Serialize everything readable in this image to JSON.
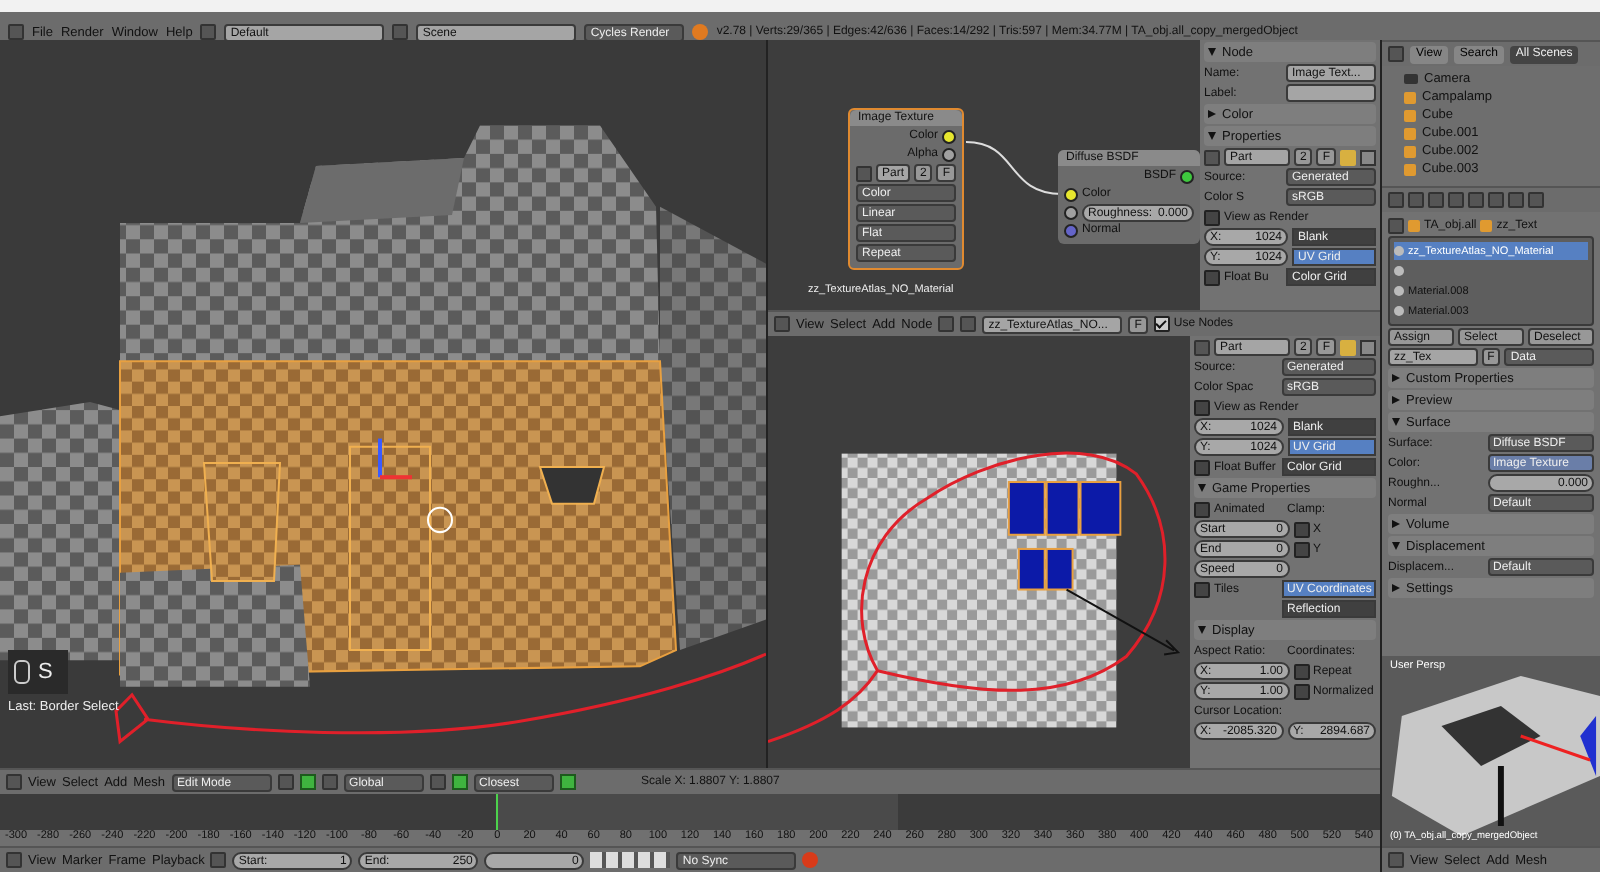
{
  "top_bar": {
    "menus": [
      "File",
      "Render",
      "Window",
      "Help"
    ],
    "screen_layout": "Default",
    "scene": "Scene",
    "render_engine": "Cycles Render",
    "stats": "v2.78 | Verts:29/365 | Edges:42/636 | Faces:14/292 | Tris:597 | Mem:34.77M | TA_obj.all_copy_mergedObject"
  },
  "viewport_3d": {
    "key_hint": "S",
    "last_operator": "Last: Border Select",
    "header": {
      "menus": [
        "View",
        "Select",
        "Add",
        "Mesh"
      ],
      "mode": "Edit Mode",
      "orientation": "Global",
      "snap_target": "Closest",
      "status": "Scale X: 1.8807  Y: 1.8807"
    }
  },
  "node_editor": {
    "image_node": {
      "title": "Image Texture",
      "outputs": [
        "Color",
        "Alpha"
      ],
      "image": "Part",
      "users": "2",
      "fake": "F",
      "options": [
        "Color",
        "Linear",
        "Flat",
        "Repeat"
      ],
      "image_label": "zz_TextureAtlas_NO_Material"
    },
    "diffuse_node": {
      "title": "Diffuse BSDF",
      "output": "BSDF",
      "color_input": "Color",
      "roughness_label": "Roughness:",
      "roughness_value": "0.000",
      "normal_input": "Normal"
    },
    "header": {
      "menus": [
        "View",
        "Select",
        "Add",
        "Node"
      ],
      "material": "zz_TextureAtlas_NO...",
      "fake": "F",
      "use_nodes_label": "Use Nodes",
      "use_nodes": true
    },
    "sidebar": {
      "rows": [
        {
          "kind": "panel",
          "title": "Node",
          "expanded": true
        },
        {
          "kind": "line",
          "cells": [
            {
              "kind": "label",
              "label": "Name:"
            },
            {
              "kind": "field",
              "value": "Image Text..."
            }
          ]
        },
        {
          "kind": "line",
          "cells": [
            {
              "kind": "label",
              "label": "Label:"
            },
            {
              "kind": "field"
            }
          ]
        },
        {
          "kind": "panel",
          "title": "Color",
          "expanded": false
        },
        {
          "kind": "panel",
          "title": "Properties",
          "expanded": true
        },
        {
          "kind": "image",
          "name": "Part",
          "users": "2",
          "fake": "F"
        },
        {
          "kind": "line",
          "cells": [
            {
              "kind": "label",
              "label": "Source:"
            },
            {
              "kind": "dropdown",
              "value": "Generated"
            }
          ]
        },
        {
          "kind": "line",
          "cells": [
            {
              "kind": "label",
              "label": "Color S"
            },
            {
              "kind": "dropdown",
              "value": "sRGB"
            }
          ]
        },
        {
          "kind": "line",
          "cells": [
            {
              "kind": "check",
              "label": "View as Render",
              "checked": false
            }
          ]
        },
        {
          "kind": "line",
          "cells": [
            {
              "kind": "number",
              "label": "X:",
              "value": "1024"
            },
            {
              "kind": "option",
              "label": "Blank",
              "selected": false
            }
          ]
        },
        {
          "kind": "line",
          "cells": [
            {
              "kind": "number",
              "label": "Y:",
              "value": "1024"
            },
            {
              "kind": "option",
              "label": "UV Grid",
              "selected": true
            }
          ]
        },
        {
          "kind": "line",
          "cells": [
            {
              "kind": "check",
              "label": "Float Bu",
              "checked": false
            },
            {
              "kind": "option",
              "label": "Color Grid",
              "selected": false
            }
          ]
        }
      ]
    }
  },
  "image_editor": {
    "sidebar": {
      "rows": [
        {
          "kind": "image",
          "name": "Part",
          "users": "2",
          "fake": "F"
        },
        {
          "kind": "line",
          "cells": [
            {
              "kind": "label",
              "label": "Source:"
            },
            {
              "kind": "dropdown",
              "value": "Generated"
            }
          ]
        },
        {
          "kind": "line",
          "cells": [
            {
              "kind": "label",
              "label": "Color Spac"
            },
            {
              "kind": "dropdown",
              "value": "sRGB"
            }
          ]
        },
        {
          "kind": "line",
          "cells": [
            {
              "kind": "check",
              "label": "View as Render",
              "checked": false
            }
          ]
        },
        {
          "kind": "line",
          "cells": [
            {
              "kind": "number",
              "label": "X:",
              "value": "1024"
            },
            {
              "kind": "option",
              "label": "Blank",
              "selected": false
            }
          ]
        },
        {
          "kind": "line",
          "cells": [
            {
              "kind": "number",
              "label": "Y:",
              "value": "1024"
            },
            {
              "kind": "option",
              "label": "UV Grid",
              "selected": true
            }
          ]
        },
        {
          "kind": "line",
          "cells": [
            {
              "kind": "check",
              "label": "Float Buffer",
              "checked": false
            },
            {
              "kind": "option",
              "label": "Color Grid",
              "selected": false
            }
          ]
        },
        {
          "kind": "panel",
          "title": "Game Properties",
          "expanded": true
        },
        {
          "kind": "line",
          "cells": [
            {
              "kind": "check",
              "label": "Animated",
              "checked": false
            },
            {
              "kind": "label",
              "label": "Clamp:"
            }
          ]
        },
        {
          "kind": "line",
          "cells": [
            {
              "kind": "number",
              "label": "Start",
              "value": "0"
            },
            {
              "kind": "check",
              "label": "X",
              "checked": false
            }
          ]
        },
        {
          "kind": "line",
          "cells": [
            {
              "kind": "number",
              "label": "End",
              "value": "0"
            },
            {
              "kind": "check",
              "label": "Y",
              "checked": false
            }
          ]
        },
        {
          "kind": "line",
          "cells": [
            {
              "kind": "number",
              "label": "Speed",
              "value": "0"
            },
            {
              "kind": "gap"
            }
          ]
        },
        {
          "kind": "line",
          "cells": [
            {
              "kind": "check",
              "label": "Tiles",
              "checked": false
            },
            {
              "kind": "option",
              "label": "UV Coordinates",
              "selected": true
            }
          ]
        },
        {
          "kind": "line",
          "cells": [
            {
              "kind": "gap"
            },
            {
              "kind": "option",
              "label": "Reflection",
              "selected": false
            }
          ]
        },
        {
          "kind": "panel",
          "title": "Display",
          "expanded": true
        },
        {
          "kind": "line",
          "cells": [
            {
              "kind": "label",
              "label": "Aspect Ratio:"
            },
            {
              "kind": "label",
              "label": "Coordinates:"
            }
          ]
        },
        {
          "kind": "line",
          "cells": [
            {
              "kind": "number",
              "label": "X:",
              "value": "1.00"
            },
            {
              "kind": "check",
              "label": "Repeat",
              "checked": false
            }
          ]
        },
        {
          "kind": "line",
          "cells": [
            {
              "kind": "number",
              "label": "Y:",
              "value": "1.00"
            },
            {
              "kind": "check",
              "label": "Normalized",
              "checked": false
            }
          ]
        },
        {
          "kind": "line",
          "cells": [
            {
              "kind": "label",
              "label": "Cursor Location:"
            }
          ]
        },
        {
          "kind": "line",
          "cells": [
            {
              "kind": "number",
              "label": "X:",
              "value": "-2085.320"
            },
            {
              "kind": "number",
              "label": "Y:",
              "value": "2894.687"
            }
          ]
        }
      ]
    }
  },
  "outliner": {
    "tabs": [
      {
        "label": "View",
        "selected": false
      },
      {
        "label": "Search",
        "selected": false
      },
      {
        "label": "All Scenes",
        "selected": true
      }
    ],
    "items": [
      {
        "label": "Camera",
        "kind": "camera"
      },
      {
        "label": "Campalamp",
        "kind": "object"
      },
      {
        "label": "Cube",
        "kind": "object"
      },
      {
        "label": "Cube.001",
        "kind": "object"
      },
      {
        "label": "Cube.002",
        "kind": "object"
      },
      {
        "label": "Cube.003",
        "kind": "object"
      }
    ]
  },
  "properties": {
    "rows": [
      {
        "kind": "path",
        "items": [
          "TA_obj.all",
          "zz_Text"
        ]
      },
      {
        "kind": "list",
        "items": [
          {
            "label": "zz_TextureAtlas_NO_Material",
            "selected": true
          },
          {
            "selected": false
          },
          {
            "label": "Material.008",
            "selected": false
          },
          {
            "label": "Material.003",
            "selected": false
          }
        ]
      },
      {
        "kind": "buttons",
        "items": [
          "Assign",
          "Select",
          "Deselect"
        ]
      },
      {
        "kind": "line",
        "cells": [
          {
            "kind": "field",
            "value": "zz_Tex"
          },
          {
            "kind": "button",
            "label": "F"
          },
          {
            "kind": "dropdown",
            "value": "Data"
          }
        ]
      },
      {
        "kind": "panel",
        "title": "Custom Properties",
        "expanded": false
      },
      {
        "kind": "panel",
        "title": "Preview",
        "expanded": false
      },
      {
        "kind": "panel",
        "title": "Surface",
        "expanded": true
      },
      {
        "kind": "line",
        "cells": [
          {
            "kind": "label",
            "label": "Surface:"
          },
          {
            "kind": "dropdown",
            "value": "Diffuse BSDF"
          }
        ]
      },
      {
        "kind": "line",
        "cells": [
          {
            "kind": "label",
            "label": "Color:"
          },
          {
            "kind": "link",
            "value": "Image Texture"
          }
        ]
      },
      {
        "kind": "line",
        "cells": [
          {
            "kind": "label",
            "label": "Roughn..."
          },
          {
            "kind": "number",
            "value": "0.000"
          }
        ]
      },
      {
        "kind": "line",
        "cells": [
          {
            "kind": "label",
            "label": "Normal"
          },
          {
            "kind": "dropdown",
            "value": "Default"
          }
        ]
      },
      {
        "kind": "panel",
        "title": "Volume",
        "expanded": false
      },
      {
        "kind": "panel",
        "title": "Displacement",
        "expanded": true
      },
      {
        "kind": "line",
        "cells": [
          {
            "kind": "label",
            "label": "Displacem..."
          },
          {
            "kind": "dropdown",
            "value": "Default"
          }
        ]
      },
      {
        "kind": "panel",
        "title": "Settings",
        "expanded": false
      }
    ]
  },
  "mini_viewport": {
    "view_label": "User Persp",
    "object_label": "(0) TA_obj.all_copy_mergedObject",
    "header": {
      "menus": [
        "View",
        "Select",
        "Add",
        "Mesh"
      ]
    }
  },
  "timeline": {
    "ticks": [
      "-300",
      "-280",
      "-260",
      "-240",
      "-220",
      "-200",
      "-180",
      "-160",
      "-140",
      "-120",
      "-100",
      "-80",
      "-60",
      "-40",
      "-20",
      "0",
      "20",
      "40",
      "60",
      "80",
      "100",
      "120",
      "140",
      "160",
      "180",
      "200",
      "220",
      "240",
      "260",
      "280",
      "300",
      "320",
      "340",
      "360",
      "380",
      "400",
      "420",
      "440",
      "460",
      "480",
      "500",
      "520",
      "540"
    ],
    "header": {
      "menus": [
        "View",
        "Marker",
        "Frame",
        "Playback"
      ],
      "start_label": "Start:",
      "start": "1",
      "end_label": "End:",
      "end": "250",
      "frame": "0",
      "sync": "No Sync"
    }
  }
}
